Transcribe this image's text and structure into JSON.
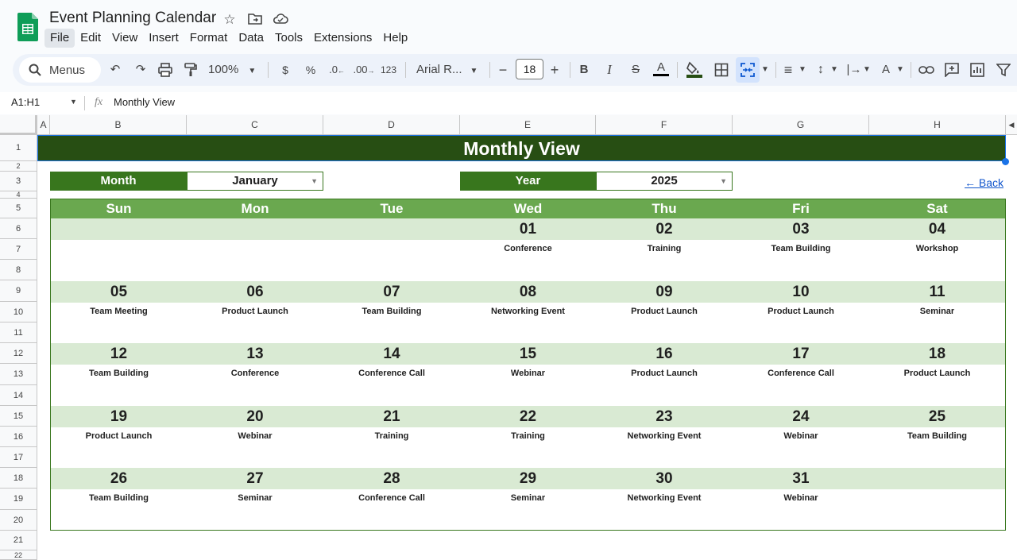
{
  "app": {
    "doc_title": "Event Planning Calendar",
    "menu": [
      "File",
      "Edit",
      "View",
      "Insert",
      "Format",
      "Data",
      "Tools",
      "Extensions",
      "Help"
    ],
    "active_menu": "File"
  },
  "toolbar": {
    "menus_label": "Menus",
    "zoom": "100%",
    "currency": "$",
    "percent": "%",
    "dec_decrease": ".0",
    "dec_increase": ".00",
    "number_format": "123",
    "font": "Arial R...",
    "font_size": "18",
    "bold": "B",
    "italic": "I",
    "strike": "S",
    "text_color": "A"
  },
  "formula_bar": {
    "name_box": "A1:H1",
    "fx": "fx",
    "content": "Monthly View"
  },
  "columns": [
    "A",
    "B",
    "C",
    "D",
    "E",
    "F",
    "G",
    "H"
  ],
  "rows": [
    "1",
    "2",
    "3",
    "4",
    "5",
    "6",
    "7",
    "8",
    "9",
    "10",
    "11",
    "12",
    "13",
    "14",
    "15",
    "16",
    "17",
    "18",
    "19",
    "20",
    "21",
    "22"
  ],
  "sheet": {
    "banner": "Monthly View",
    "month_label": "Month",
    "month_value": "January",
    "year_label": "Year",
    "year_value": "2025",
    "back_link": "← Back",
    "day_headers": [
      "Sun",
      "Mon",
      "Tue",
      "Wed",
      "Thu",
      "Fri",
      "Sat"
    ],
    "weeks": [
      [
        {
          "d": "",
          "e": ""
        },
        {
          "d": "",
          "e": ""
        },
        {
          "d": "",
          "e": ""
        },
        {
          "d": "01",
          "e": "Conference"
        },
        {
          "d": "02",
          "e": "Training"
        },
        {
          "d": "03",
          "e": "Team Building"
        },
        {
          "d": "04",
          "e": "Workshop"
        }
      ],
      [
        {
          "d": "05",
          "e": "Team Meeting"
        },
        {
          "d": "06",
          "e": "Product Launch"
        },
        {
          "d": "07",
          "e": "Team Building"
        },
        {
          "d": "08",
          "e": "Networking Event"
        },
        {
          "d": "09",
          "e": "Product Launch"
        },
        {
          "d": "10",
          "e": "Product Launch"
        },
        {
          "d": "11",
          "e": "Seminar"
        }
      ],
      [
        {
          "d": "12",
          "e": "Team Building"
        },
        {
          "d": "13",
          "e": "Conference"
        },
        {
          "d": "14",
          "e": "Conference Call"
        },
        {
          "d": "15",
          "e": "Webinar"
        },
        {
          "d": "16",
          "e": "Product Launch"
        },
        {
          "d": "17",
          "e": "Conference Call"
        },
        {
          "d": "18",
          "e": "Product Launch"
        }
      ],
      [
        {
          "d": "19",
          "e": "Product Launch"
        },
        {
          "d": "20",
          "e": "Webinar"
        },
        {
          "d": "21",
          "e": "Training"
        },
        {
          "d": "22",
          "e": "Training"
        },
        {
          "d": "23",
          "e": "Networking Event"
        },
        {
          "d": "24",
          "e": "Webinar"
        },
        {
          "d": "25",
          "e": "Team Building"
        }
      ],
      [
        {
          "d": "26",
          "e": "Team Building"
        },
        {
          "d": "27",
          "e": "Seminar"
        },
        {
          "d": "28",
          "e": "Conference Call"
        },
        {
          "d": "29",
          "e": "Seminar"
        },
        {
          "d": "30",
          "e": "Networking Event"
        },
        {
          "d": "31",
          "e": "Webinar"
        },
        {
          "d": "",
          "e": ""
        }
      ]
    ]
  },
  "colors": {
    "banner": "#274e13",
    "label": "#38761d",
    "day_header": "#6aa84f",
    "week_band": "#d9ead3",
    "link": "#1155cc"
  }
}
